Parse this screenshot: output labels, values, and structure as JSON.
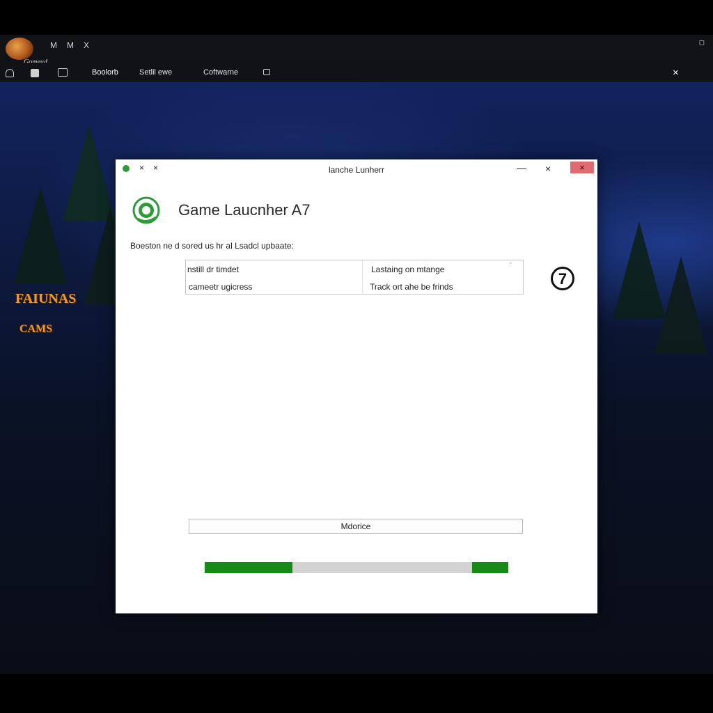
{
  "window": {
    "app_logo_text": "Gomeud",
    "top_controls": [
      "M",
      "M",
      "X"
    ],
    "top_right_control": "◻",
    "tabs": [
      {
        "label": "Boolorb",
        "active": true
      },
      {
        "label": "Setlil ewe",
        "active": false
      },
      {
        "label": "Coftwarne",
        "active": false
      }
    ],
    "close_symbol": "×"
  },
  "side_logos": [
    "FAIUNAS",
    "CAMS"
  ],
  "dialog": {
    "title": "lanche Lunherr",
    "title_small_controls": [
      "×",
      "×"
    ],
    "minimize_symbol": "—",
    "maximize_symbol": "×",
    "close_symbol": "×",
    "app_name": "Game Laucnher A7",
    "subtitle": "Boeston ne d sored us hr al Lsadcl upbaate:",
    "options": {
      "left_top": "nstill dr timdet",
      "left_bottom": "cameetr ugicress",
      "right_top": "Lastaing on mtange",
      "right_bottom": "Track ort ahe be frinds",
      "dropdown_symbol": "ˇ"
    },
    "help_badge": "7",
    "module_button": "Mdorice",
    "progress": {
      "fill_fraction": 0.29,
      "tail_fraction": 0.12,
      "fill_color": "#178a17",
      "track_color": "#d3d3d3"
    }
  },
  "colors": {
    "dialog_close_bg": "#e06b72",
    "accent_green": "#2e9a3a"
  }
}
